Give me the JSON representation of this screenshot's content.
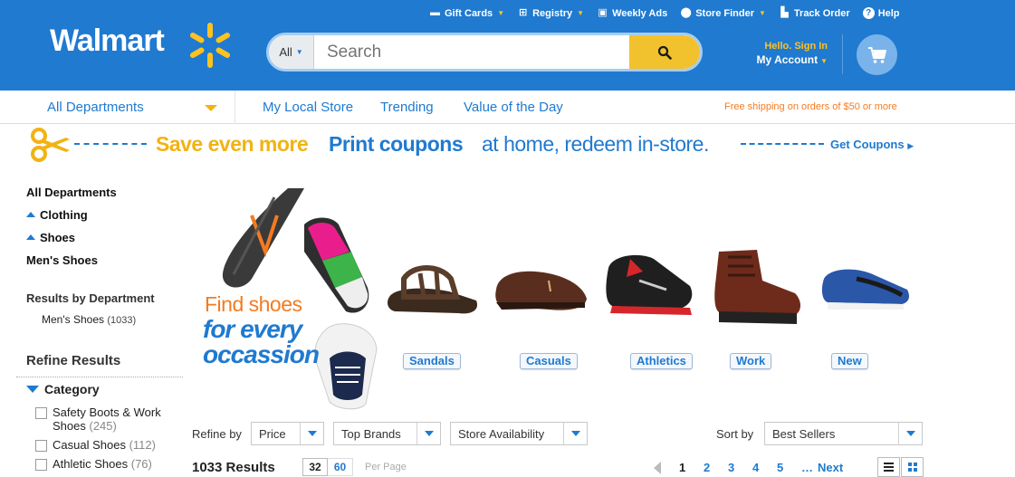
{
  "header": {
    "logo": "Walmart",
    "top_links": [
      {
        "label": "Gift Cards",
        "icon": "gift-card-icon",
        "has_caret": true
      },
      {
        "label": "Registry",
        "icon": "gift-icon",
        "has_caret": true
      },
      {
        "label": "Weekly Ads",
        "icon": "news-icon",
        "has_caret": false
      },
      {
        "label": "Store Finder",
        "icon": "map-pin-icon",
        "has_caret": true
      },
      {
        "label": "Track Order",
        "icon": "truck-icon",
        "has_caret": false
      },
      {
        "label": "Help",
        "icon": "help-icon",
        "has_caret": false
      }
    ],
    "search": {
      "scope": "All",
      "placeholder": "Search"
    },
    "account": {
      "hello": "Hello. Sign In",
      "my_account": "My Account"
    }
  },
  "nav": {
    "all_departments": "All Departments",
    "links": [
      "My Local Store",
      "Trending",
      "Value of the Day"
    ],
    "free_shipping": "Free shipping on orders of $50 or more"
  },
  "coupon": {
    "save": "Save even more",
    "print": "Print coupons",
    "rest": "at home, redeem in-store.",
    "get": "Get Coupons"
  },
  "sidebar": {
    "all_departments": "All Departments",
    "clothing": "Clothing",
    "shoes": "Shoes",
    "mens_shoes": "Men's Shoes",
    "results_by_department": "Results by Department",
    "department_item": "Men's Shoes",
    "department_count": "(1033)",
    "refine_results": "Refine Results",
    "category": "Category",
    "categories": [
      {
        "label": "Safety Boots & Work",
        "label2": "Shoes",
        "count": "(245)"
      },
      {
        "label": "Casual Shoes",
        "count": "(112)"
      },
      {
        "label": "Athletic Shoes",
        "count": "(76)"
      }
    ]
  },
  "hero": {
    "line1": "Find shoes",
    "line2": "for every",
    "line3": "occassion",
    "buttons": [
      "Sandals",
      "Casuals",
      "Athletics",
      "Work",
      "New"
    ]
  },
  "refine_bar": {
    "label": "Refine by",
    "filters": [
      "Price",
      "Top Brands",
      "Store Availability"
    ],
    "sort_label": "Sort by",
    "sort_value": "Best Sellers"
  },
  "results_bar": {
    "count": "1033 Results",
    "per_page_options": [
      "32",
      "60"
    ],
    "per_page_label": "Per Page",
    "pages": [
      "1",
      "2",
      "3",
      "4",
      "5"
    ],
    "ellipsis": "…",
    "next": "Next"
  },
  "colors": {
    "brand_blue": "#1f7ad0",
    "spark_yellow": "#ffc220",
    "search_button": "#f2c12e",
    "shipping_orange": "#f47b20"
  }
}
